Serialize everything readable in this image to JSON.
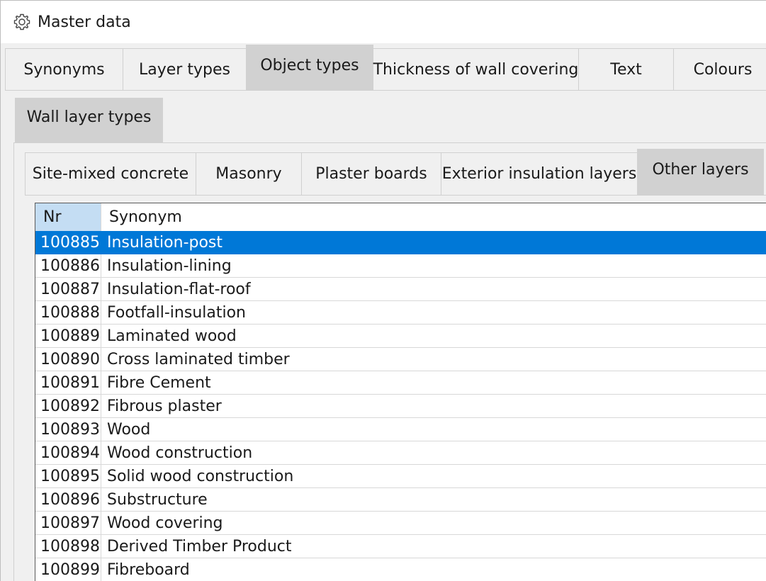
{
  "window": {
    "title": "Master data",
    "icon": "gear-icon"
  },
  "tabs_main": [
    {
      "label": "Synonyms",
      "active": false
    },
    {
      "label": "Layer types",
      "active": false
    },
    {
      "label": "Object types",
      "active": true
    },
    {
      "label": "Thickness of wall covering",
      "active": false
    },
    {
      "label": "Text",
      "active": false
    },
    {
      "label": "Colours",
      "active": false
    }
  ],
  "tabs_sub": [
    {
      "label": "Wall layer types",
      "active": true
    }
  ],
  "tabs_category": [
    {
      "label": "Site-mixed concrete",
      "active": false
    },
    {
      "label": "Masonry",
      "active": false
    },
    {
      "label": "Plaster boards",
      "active": false
    },
    {
      "label": "Exterior insulation layers",
      "active": false
    },
    {
      "label": "Other layers",
      "active": true
    }
  ],
  "table": {
    "columns": [
      "Nr",
      "Synonym"
    ],
    "rows": [
      {
        "nr": "100885",
        "synonym": "Insulation-post",
        "selected": true
      },
      {
        "nr": "100886",
        "synonym": "Insulation-lining"
      },
      {
        "nr": "100887",
        "synonym": "Insulation-flat-roof"
      },
      {
        "nr": "100888",
        "synonym": "Footfall-insulation"
      },
      {
        "nr": "100889",
        "synonym": "Laminated wood"
      },
      {
        "nr": "100890",
        "synonym": "Cross laminated timber"
      },
      {
        "nr": "100891",
        "synonym": "Fibre Cement"
      },
      {
        "nr": "100892",
        "synonym": "Fibrous plaster"
      },
      {
        "nr": "100893",
        "synonym": "Wood"
      },
      {
        "nr": "100894",
        "synonym": "Wood construction"
      },
      {
        "nr": "100895",
        "synonym": "Solid wood construction"
      },
      {
        "nr": "100896",
        "synonym": "Substructure"
      },
      {
        "nr": "100897",
        "synonym": "Wood covering"
      },
      {
        "nr": "100898",
        "synonym": "Derived Timber Product"
      },
      {
        "nr": "100899",
        "synonym": "Fibreboard"
      }
    ]
  },
  "colors": {
    "selection": "#0078d7",
    "header_nr": "#c4ddf3",
    "active_tab": "#d1d1d1"
  }
}
